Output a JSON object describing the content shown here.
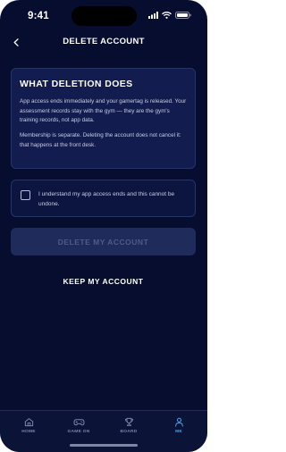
{
  "status_bar": {
    "time": "9:41",
    "icons": [
      "signal-icon",
      "wifi-icon",
      "battery-icon"
    ]
  },
  "header": {
    "back_icon": "chevron-left-icon",
    "title": "DELETE ACCOUNT"
  },
  "info_card": {
    "heading": "WHAT DELETION DOES",
    "paragraph_1": "App access ends immediately and your gamertag is released. Your assessment records stay with the gym — they are the gym's training records, not app data.",
    "paragraph_2": "Membership is separate. Deleting the account does not cancel it: that happens at the front desk."
  },
  "confirmation": {
    "checked": false,
    "label": "I understand my app access ends and this cannot be undone."
  },
  "actions": {
    "delete_label": "DELETE MY ACCOUNT",
    "delete_enabled": false,
    "keep_label": "KEEP MY ACCOUNT"
  },
  "tab_bar": {
    "tabs": [
      {
        "label": "HOME",
        "icon": "home-icon",
        "active": false
      },
      {
        "label": "GAME ON",
        "icon": "gamepad-icon",
        "active": false
      },
      {
        "label": "BOARD",
        "icon": "trophy-icon",
        "active": false
      },
      {
        "label": "ME",
        "icon": "person-icon",
        "active": true
      }
    ]
  },
  "colors": {
    "background": "#070d2e",
    "card": "#121c4e",
    "accent": "#4aa3f0",
    "disabled_text": "#4f5b87"
  }
}
